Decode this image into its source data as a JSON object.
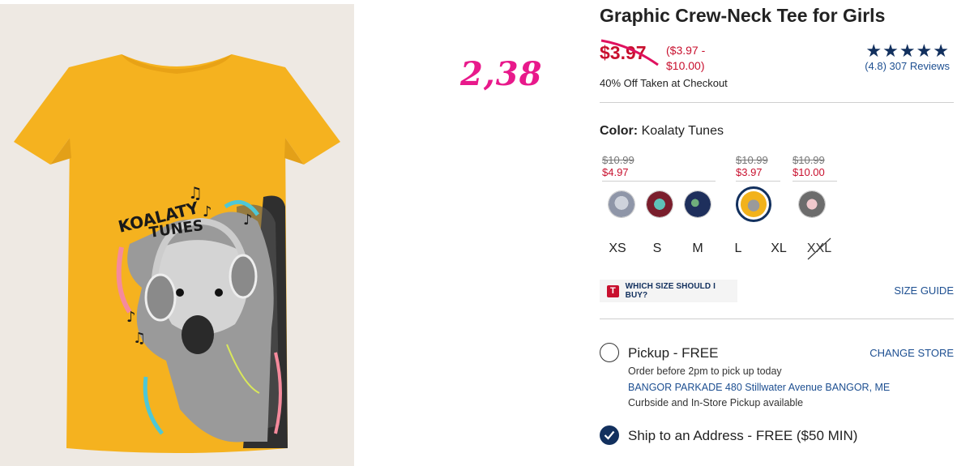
{
  "product": {
    "title": "Graphic Crew-Neck Tee for Girls",
    "image_graphic_text_line1": "KOALATY",
    "image_graphic_text_line2": "TUNES"
  },
  "annotation": {
    "text": "2,38"
  },
  "pricing": {
    "current": "$3.97",
    "range_line1": "($3.97 -",
    "range_line2": "$10.00)",
    "checkout_note": "40% Off Taken at Checkout"
  },
  "rating": {
    "stars": "★★★★★",
    "value": 4.8,
    "reviews_text": "(4.8) 307 Reviews"
  },
  "color": {
    "label": "Color:",
    "selected": "Koalaty Tunes",
    "groups": [
      {
        "old": "$10.99",
        "new": "$4.97"
      },
      {
        "old": "$10.99",
        "new": "$3.97"
      },
      {
        "old": "$10.99",
        "new": "$10.00"
      }
    ],
    "swatches": [
      {
        "name": "gray-koala",
        "color": "#8f96a8"
      },
      {
        "name": "maroon-globe",
        "color": "#7a1e2c"
      },
      {
        "name": "navy-floral",
        "color": "#1e2f5c"
      },
      {
        "name": "koalaty-tunes",
        "color": "#f2b21c"
      },
      {
        "name": "gray-floral",
        "color": "#6c6c6c"
      }
    ]
  },
  "sizes": [
    "XS",
    "S",
    "M",
    "L",
    "XL",
    "XXL"
  ],
  "size_help": {
    "badge": "T",
    "which_size": "WHICH SIZE SHOULD I BUY?",
    "size_guide": "SIZE GUIDE"
  },
  "fulfillment": {
    "pickup_label": "Pickup - FREE",
    "change_store": "CHANGE STORE",
    "pickup_note": "Order before 2pm to pick up today",
    "store_line": "BANGOR PARKADE 480 Stillwater Avenue  BANGOR, ME",
    "curbside": "Curbside and In-Store Pickup available",
    "ship_label": "Ship to an Address - FREE ($50 MIN)"
  },
  "colors": {
    "sale_red": "#c8102e",
    "navy": "#12305e",
    "link_blue": "#1d4f91",
    "annotation_pink": "#e8198b",
    "shirt_yellow": "#f5b21f"
  }
}
